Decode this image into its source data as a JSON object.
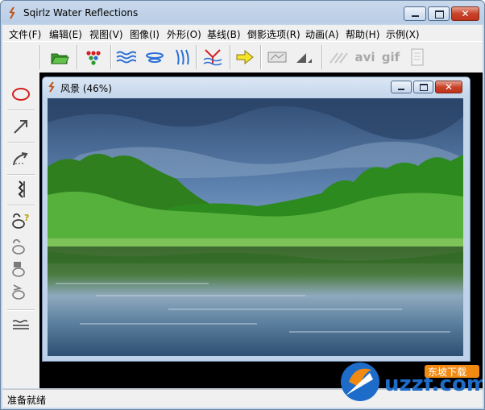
{
  "window": {
    "title": "Sqirlz Water Reflections",
    "controls": {
      "minimize": "minimize",
      "maximize": "maximize",
      "close": "✕"
    }
  },
  "menu": [
    "文件(F)",
    "编辑(E)",
    "视图(V)",
    "图像(I)",
    "外形(O)",
    "基线(B)",
    "倒影选项(R)",
    "动画(A)",
    "帮助(H)",
    "示例(X)"
  ],
  "toolbar": {
    "buttons": [
      "open-folder-icon",
      "color-dots-icon",
      "ripple-wave-icon",
      "horizontal-ripple-icon",
      "diagonal-ripple-icon",
      "baseline-reflect-icon",
      "yellow-arrow-icon",
      "mask-icon",
      "triangle-angle-icon",
      "line-draw-icon"
    ],
    "avi_label": "avi",
    "gif_label": "gif"
  },
  "sidebar_tools": [
    "ellipse-tool-icon",
    "arrow-tool-icon",
    "curve-arrow-tool-icon",
    "zigzag-tool-icon",
    "help-shape-icon",
    "shape-tool-2-icon",
    "shape-tool-3-icon",
    "shape-tool-4-icon",
    "wave-lines-icon"
  ],
  "child_window": {
    "title": "风景",
    "zoom": "(46%)"
  },
  "status": {
    "text": "准备就绪"
  },
  "watermark": {
    "brand": "uzzf.com",
    "cn": "东坡下载"
  },
  "colors": {
    "accent": "#c0321a",
    "title_bg": "#c9d9ec",
    "sky": "#5d86b8",
    "forest": "#2f8a22",
    "water": "#3e6b86"
  }
}
